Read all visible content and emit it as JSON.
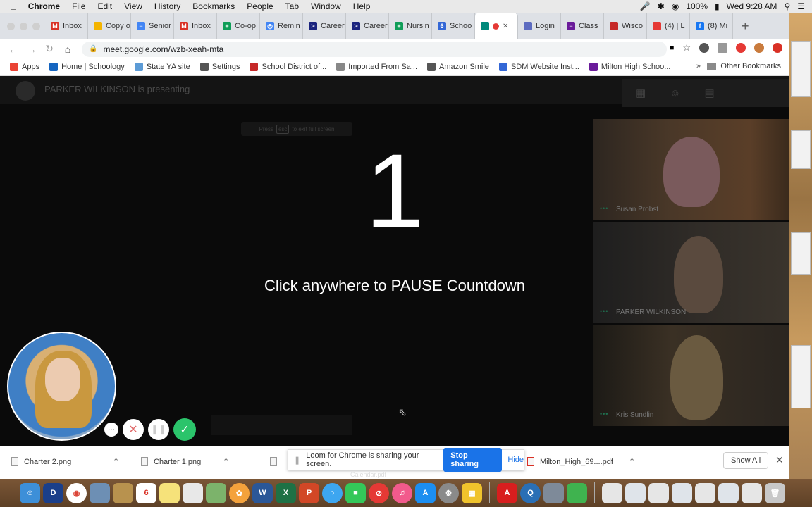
{
  "menubar": {
    "app": "Chrome",
    "items": [
      "File",
      "Edit",
      "View",
      "History",
      "Bookmarks",
      "People",
      "Tab",
      "Window",
      "Help"
    ],
    "battery": "100%",
    "clock": "Wed 9:28 AM"
  },
  "tabs": [
    {
      "label": "Inbox",
      "color": "#d93025",
      "glyph": "M"
    },
    {
      "label": "Copy o",
      "color": "#f4b400",
      "glyph": ""
    },
    {
      "label": "Senior",
      "color": "#4285f4",
      "glyph": "≡"
    },
    {
      "label": "Inbox",
      "color": "#d93025",
      "glyph": "M"
    },
    {
      "label": "Co-op",
      "color": "#0f9d58",
      "glyph": "+"
    },
    {
      "label": "Remin",
      "color": "#4285f4",
      "glyph": "◎"
    },
    {
      "label": "Career",
      "color": "#1a237e",
      "glyph": ">"
    },
    {
      "label": "Career",
      "color": "#1a237e",
      "glyph": ">"
    },
    {
      "label": "Nursin",
      "color": "#0f9d58",
      "glyph": "+"
    },
    {
      "label": "Schoo",
      "color": "#3367d6",
      "glyph": "6"
    },
    {
      "label": "",
      "color": "#00897b",
      "glyph": "",
      "active": true
    },
    {
      "label": "Login",
      "color": "#5c6bc0",
      "glyph": ""
    },
    {
      "label": "Class",
      "color": "#6a1b9a",
      "glyph": "≡"
    },
    {
      "label": "Wisco",
      "color": "#c62828",
      "glyph": ""
    },
    {
      "label": "(4) | L",
      "color": "#e53935",
      "glyph": ""
    },
    {
      "label": "(8) Mi",
      "color": "#1877f2",
      "glyph": "f"
    }
  ],
  "address": {
    "url": "meet.google.com/wzb-xeah-mta"
  },
  "bookmarks": [
    {
      "label": "Apps",
      "color": "#ea4335"
    },
    {
      "label": "Home | Schoology",
      "color": "#1565c0"
    },
    {
      "label": "State YA site",
      "color": "#5c9bd6"
    },
    {
      "label": "Settings",
      "color": "#555555"
    },
    {
      "label": "School District of...",
      "color": "#c62828"
    },
    {
      "label": "Imported From Sa...",
      "color": "#888888"
    },
    {
      "label": "Amazon Smile",
      "color": "#555555"
    },
    {
      "label": "SDM Website Inst...",
      "color": "#3367d6"
    },
    {
      "label": "Milton High Schoo...",
      "color": "#6a1b9a"
    }
  ],
  "other_bookmarks": "Other Bookmarks",
  "meet": {
    "presenting": "PARKER WILKINSON is presenting",
    "esc_hint_pre": "Press",
    "esc_key": "esc",
    "esc_hint_post": "to exit full screen",
    "countdown": "1",
    "pause_message": "Click anywhere to PAUSE Countdown",
    "participants": [
      {
        "name": "Susan Probst"
      },
      {
        "name": "PARKER WILKINSON"
      },
      {
        "name": "Kris Sundlin"
      }
    ]
  },
  "downloads": {
    "items": [
      "Charter 2.png",
      "Charter 1.png",
      "Milton_High_69....pdf"
    ],
    "share_message": "Loom for Chrome is sharing your screen.",
    "stop_label": "Stop sharing",
    "hide_label": "Hide",
    "show_all": "Show All"
  },
  "dock": {
    "caption": "Calendar.pdf",
    "calendar_day": "6"
  }
}
